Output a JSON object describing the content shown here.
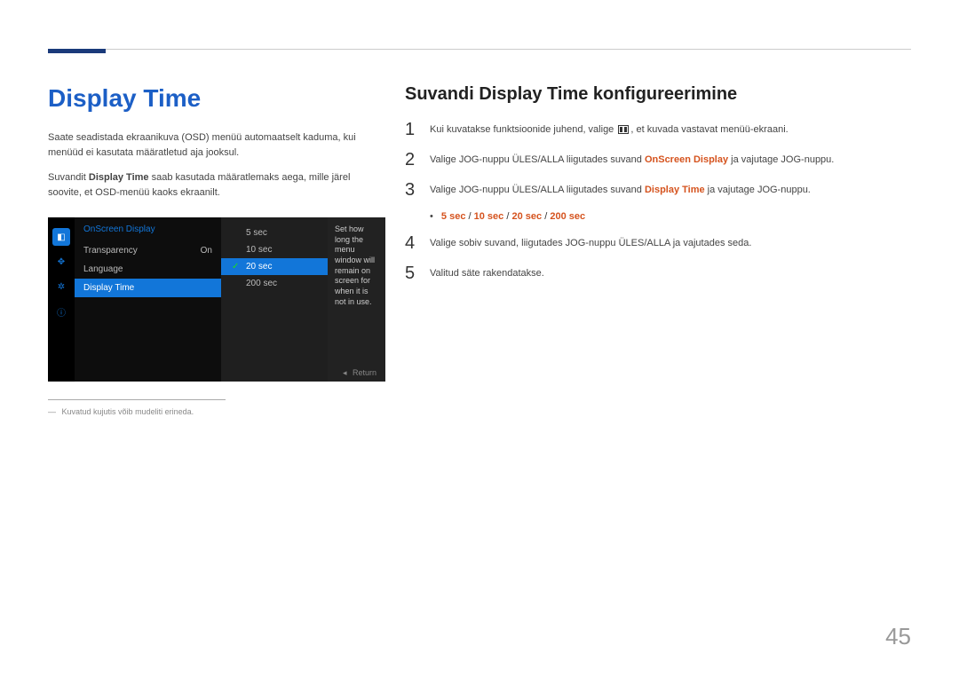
{
  "title": "Display Time",
  "para1": "Saate seadistada ekraanikuva (OSD) menüü automaatselt kaduma, kui menüüd ei kasutata määratletud aja jooksul.",
  "para2_pre": "Suvandit ",
  "para2_strong": "Display Time",
  "para2_post": " saab kasutada määratlemaks aega, mille järel soovite, et OSD-menüü kaoks ekraanilt.",
  "osd": {
    "header": "OnScreen Display",
    "rows": [
      {
        "label": "Transparency",
        "value": "On"
      },
      {
        "label": "Language",
        "value": ""
      },
      {
        "label": "Display Time",
        "value": ""
      }
    ],
    "options": [
      "5 sec",
      "10 sec",
      "20 sec",
      "200 sec"
    ],
    "desc": "Set how long the menu window will remain on screen for when it is not in use.",
    "return": "Return"
  },
  "footnote": "Kuvatud kujutis võib mudeliti erineda.",
  "subtitle": "Suvandi Display Time konfigureerimine",
  "step1_pre": "Kui kuvatakse funktsioonide juhend, valige ",
  "step1_post": " et kuvada vastavat menüü-ekraani.",
  "step2_pre": "Valige JOG-nuppu ÜLES/ALLA liigutades suvand ",
  "step2_accent": "OnScreen Display",
  "step2_post": " ja vajutage JOG-nuppu.",
  "step3_pre": "Valige JOG-nuppu ÜLES/ALLA liigutades suvand ",
  "step3_accent": "Display Time",
  "step3_post": " ja vajutage JOG-nuppu.",
  "options_line": [
    "5 sec",
    "10 sec",
    "20 sec",
    "200 sec"
  ],
  "step4": "Valige sobiv suvand, liigutades JOG-nuppu ÜLES/ALLA ja vajutades seda.",
  "step5": "Valitud säte rakendatakse.",
  "page": "45"
}
